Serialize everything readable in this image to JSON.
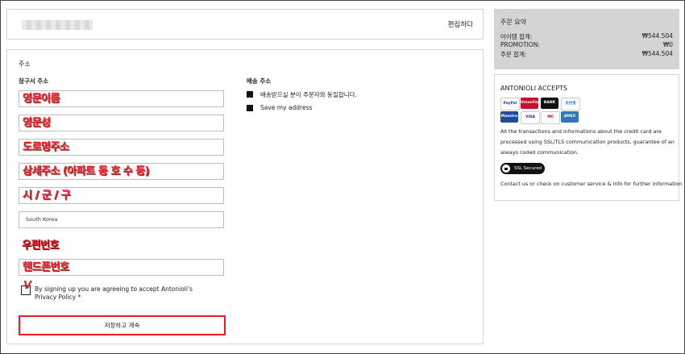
{
  "header": {
    "edit_label": "편집하다"
  },
  "address": {
    "section_title": "주소",
    "billing_title": "청구서 주소",
    "shipping_title": "배송 주소",
    "fields": [
      {
        "annotation": "영문이름",
        "value": ""
      },
      {
        "annotation": "영문성",
        "value": ""
      },
      {
        "annotation": "도로명주소",
        "value": ""
      },
      {
        "annotation": "상세주소 (아파트 동 호 수 등)",
        "value": ""
      },
      {
        "annotation": "시 / 군 / 구",
        "value": ""
      },
      {
        "annotation": "",
        "value": "South Korea"
      },
      {
        "annotation": "우편번호",
        "value": ""
      },
      {
        "annotation": "핸드폰번호",
        "value": ""
      }
    ],
    "shipping_options": [
      "배송받으실 분이 주문자와 동일합니다.",
      "Save my address"
    ],
    "consent_text": "By signing up you are agreeing to accept Antonioli's Privacy Policy *",
    "consent_mark": "V",
    "save_label": "저장하고 계속"
  },
  "summary": {
    "title": "주문 요약",
    "rows": [
      {
        "label": "아이템 합계:",
        "value": "₩544.504"
      },
      {
        "label": "PROMOTION:",
        "value": "₩0"
      },
      {
        "label": "주문 합계:",
        "value": "₩544.504"
      }
    ]
  },
  "accepts": {
    "title": "ANTONIOLI ACCEPTS",
    "cards": [
      {
        "name": "PayPal",
        "bg": "#ffffff",
        "fg": "#1a3d8f"
      },
      {
        "name": "UnionPay",
        "bg": "#c8102e",
        "fg": "#ffffff"
      },
      {
        "name": "BANK",
        "bg": "#111111",
        "fg": "#ffffff"
      },
      {
        "name": "支付宝",
        "bg": "#ffffff",
        "fg": "#1677ff"
      },
      {
        "name": "Maestro",
        "bg": "#1d4e9a",
        "fg": "#ffffff"
      },
      {
        "name": "VISA",
        "bg": "#ffffff",
        "fg": "#1a1f71"
      },
      {
        "name": "MC",
        "bg": "#ffffff",
        "fg": "#eb001b"
      },
      {
        "name": "AMEX",
        "bg": "#2e77bb",
        "fg": "#ffffff"
      }
    ],
    "info_text": "All the transactions and informations about the credit card are processed using SSL/TLS communication products, guarantee of an always coded communication.",
    "ssl_label": "SSL Secured",
    "contact_text": "Contact us or check on customer service & info for further information"
  },
  "colors": {
    "annotation_red": "#e31e24",
    "summary_bg": "#d4d4d4"
  }
}
